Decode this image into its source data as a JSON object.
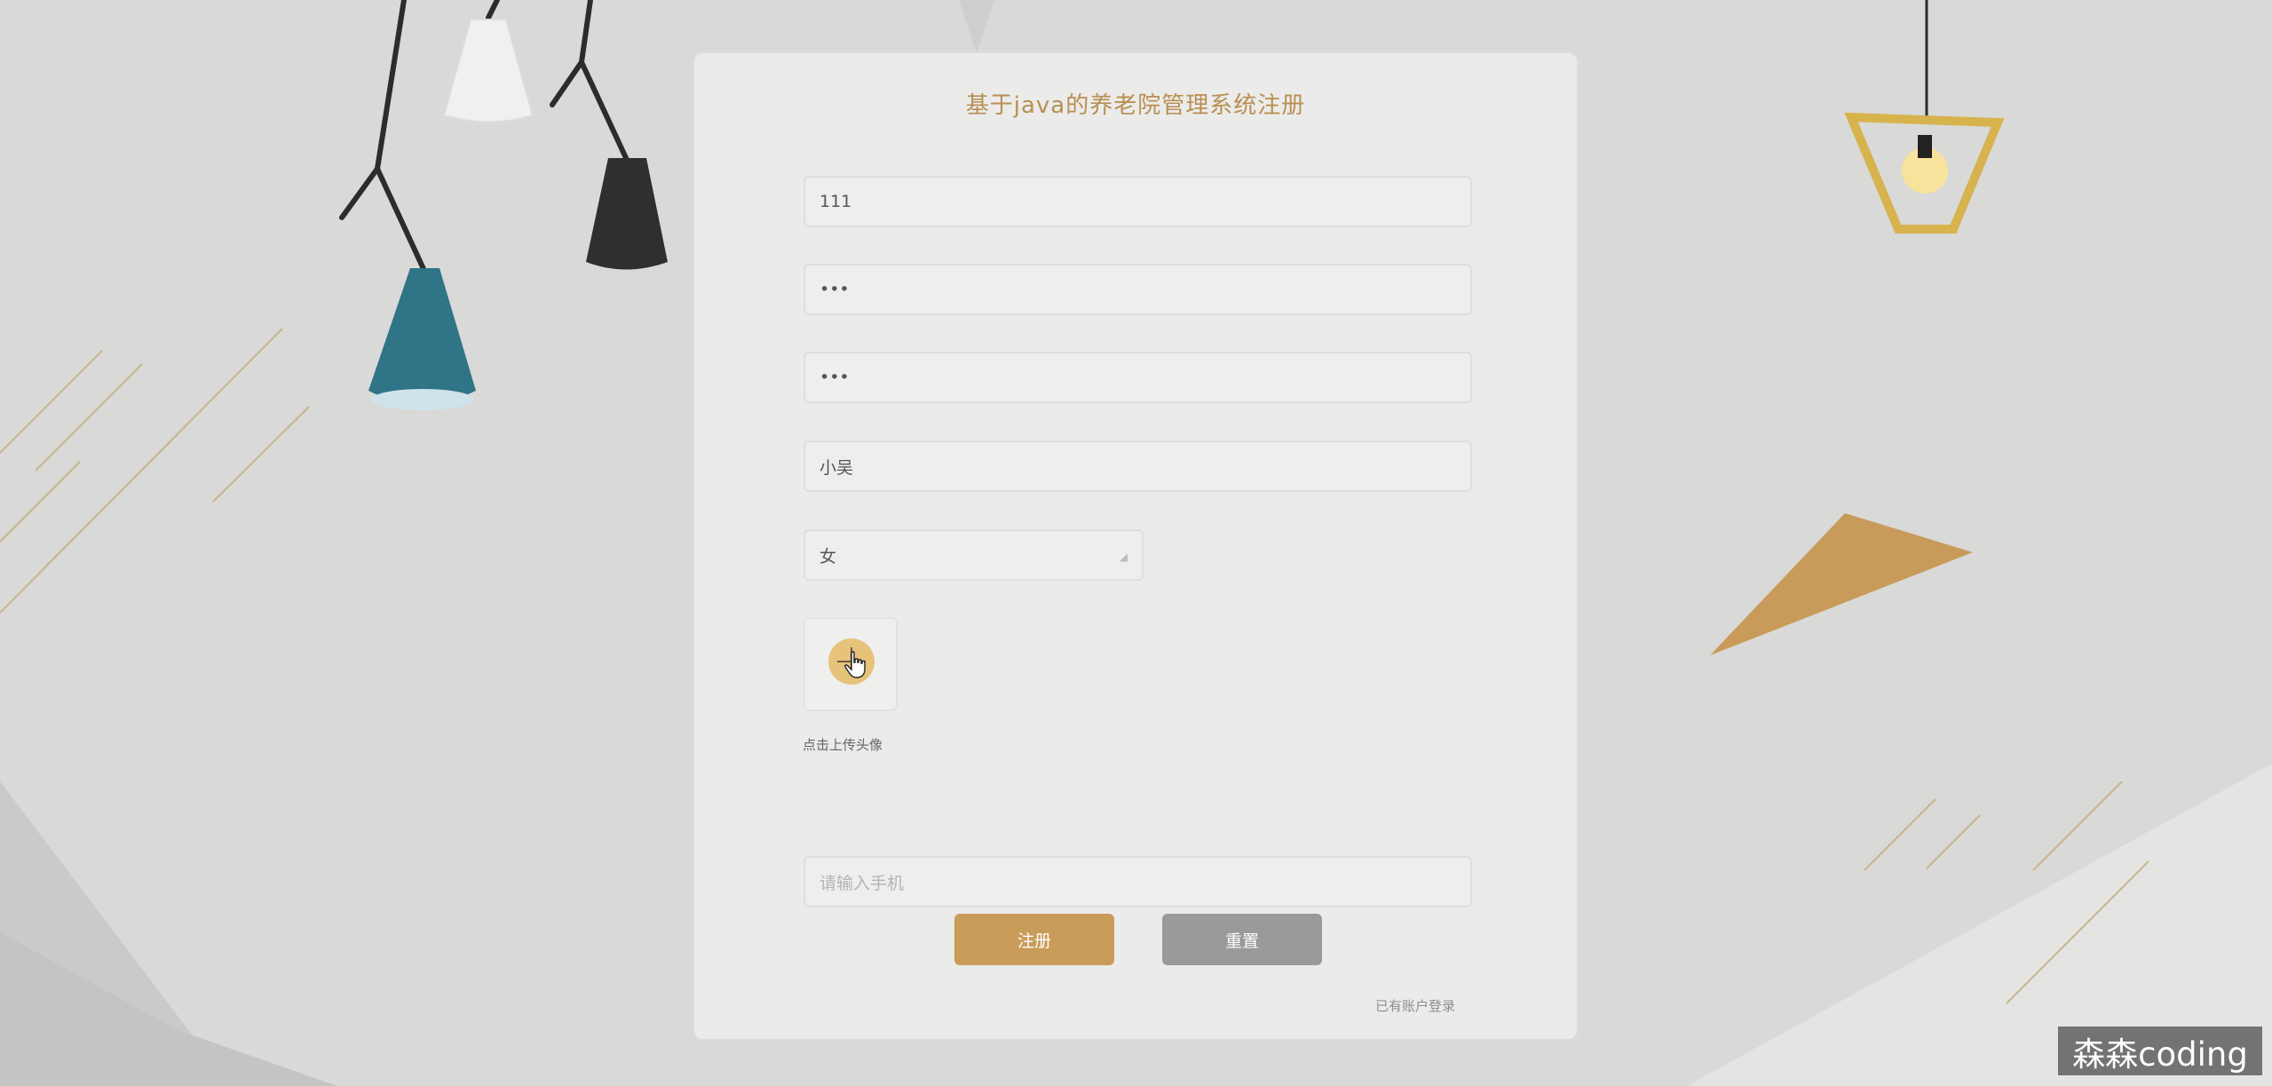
{
  "form": {
    "title": "基于java的养老院管理系统注册",
    "account_value": "111",
    "password_value": "•••",
    "confirm_password_value": "•••",
    "name_value": "小吴",
    "gender_selected": "女",
    "upload_hint": "点击上传头像",
    "phone_placeholder": "请输入手机",
    "register_label": "注册",
    "reset_label": "重置",
    "login_link": "已有账户登录"
  },
  "watermark": "森森coding",
  "colors": {
    "accent": "#c99c59",
    "title": "#b98f52",
    "reset_button": "#9a9a9a",
    "background": "#d9d9d7"
  },
  "icons": {
    "upload": "plus-icon",
    "cursor": "hand-pointer-icon",
    "select_arrow": "chevron-down-icon"
  }
}
